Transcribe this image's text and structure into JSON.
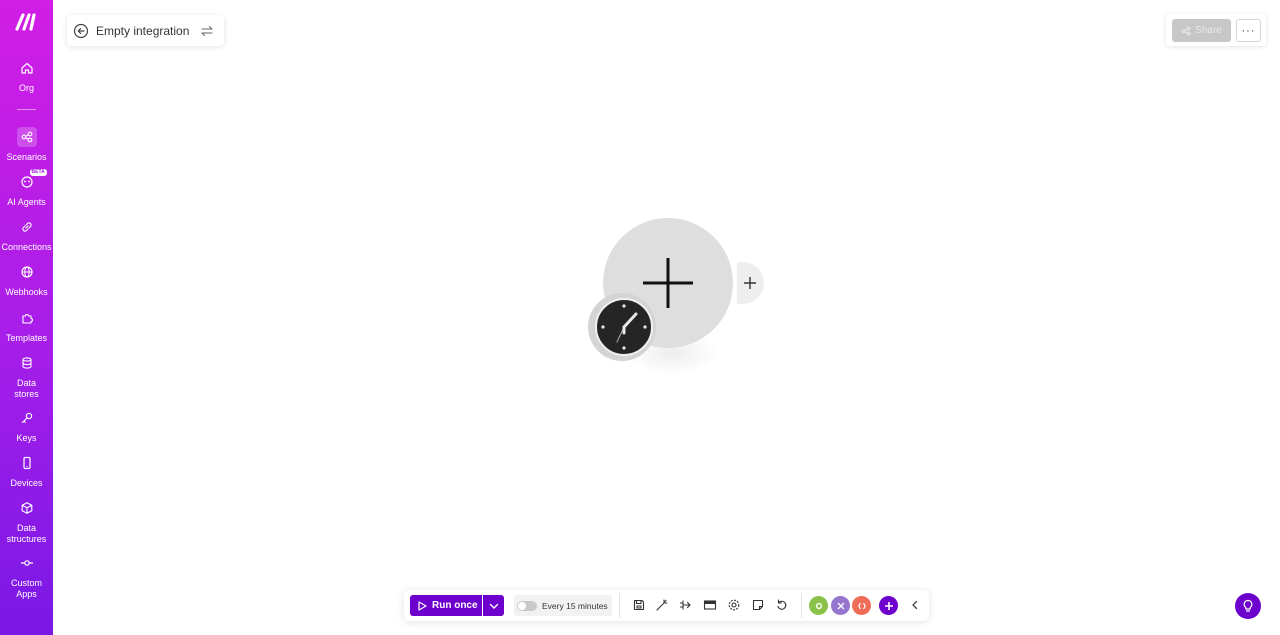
{
  "sidebar": {
    "logo": "make-logo",
    "items": [
      {
        "label": "Org",
        "icon": "home-icon"
      },
      {
        "label": "Scenarios",
        "icon": "scenarios-icon"
      },
      {
        "label": "AI Agents",
        "icon": "ai-agents-icon",
        "badge": "BETA"
      },
      {
        "label": "Connections",
        "icon": "link-icon"
      },
      {
        "label": "Webhooks",
        "icon": "globe-icon"
      },
      {
        "label": "Templates",
        "icon": "puzzle-icon"
      },
      {
        "label": "Data stores",
        "icon": "database-icon"
      },
      {
        "label": "Keys",
        "icon": "key-icon"
      },
      {
        "label": "Devices",
        "icon": "phone-icon"
      },
      {
        "label": "Data structures",
        "icon": "cube-icon"
      },
      {
        "label": "Custom Apps",
        "icon": "custom-apps-icon"
      }
    ],
    "active": "Scenarios",
    "colors": {
      "top": "#d21ee6",
      "bottom": "#7a18e6"
    }
  },
  "header": {
    "scenario_name": "Empty integration",
    "share_label": "Share",
    "more_label": "···"
  },
  "canvas": {
    "module_icon": "plus-icon",
    "trigger_icon": "clock-icon",
    "add_module_icon": "plus-icon"
  },
  "toolbar": {
    "run_label": "Run once",
    "schedule_label": "Every 15 minutes",
    "schedule_enabled": false,
    "tools": [
      "save-icon",
      "auto-align-icon",
      "explain-flow-icon",
      "scenario-io-icon",
      "settings-icon",
      "notes-icon",
      "undo-icon"
    ],
    "accent": "#6d00cc",
    "dot_colors": [
      "#8bc34a",
      "#9575cd",
      "#ef6c57"
    ]
  },
  "help": {
    "icon": "lightbulb-icon"
  }
}
